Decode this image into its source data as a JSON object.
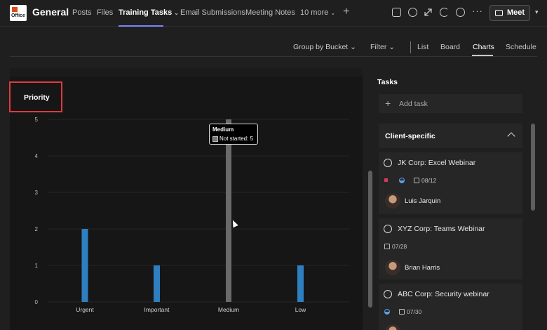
{
  "team": {
    "name": "General",
    "logo_text": "Office"
  },
  "tabs": [
    {
      "label": "Posts"
    },
    {
      "label": "Files"
    },
    {
      "label": "Training Tasks"
    },
    {
      "label": "Email Submissions"
    },
    {
      "label": "Meeting Notes"
    },
    {
      "label": "10 more"
    }
  ],
  "header_actions": {
    "meet_label": "Meet",
    "more": "···"
  },
  "viewbar": {
    "group_by": "Group by Bucket",
    "filter": "Filter",
    "list": "List",
    "board": "Board",
    "charts": "Charts",
    "schedule": "Schedule"
  },
  "chart_title": "Priority",
  "chart_data": {
    "type": "bar",
    "title": "Priority",
    "categories": [
      "Urgent",
      "Important",
      "Medium",
      "Low"
    ],
    "values": [
      2,
      1,
      5,
      1
    ],
    "ylim": [
      0,
      5
    ],
    "yticks": [
      "0",
      "1",
      "2",
      "3",
      "4",
      "5"
    ],
    "colors": [
      "#2e7fbf",
      "#2e7fbf",
      "#6a6a6a",
      "#2e7fbf"
    ],
    "highlighted": "Medium",
    "tooltip": {
      "category": "Medium",
      "label": "Not started: 5"
    },
    "grid": true
  },
  "tasks_panel": {
    "title": "Tasks",
    "add_task": "Add task",
    "bucket": "Client-specific",
    "cards": [
      {
        "title": "JK Corp: Excel Webinar",
        "due": "08/12",
        "assignee": "Luis Jarquin"
      },
      {
        "title": "XYZ Corp: Teams Webinar",
        "due": "07/28",
        "assignee": "Brian Harris"
      },
      {
        "title": "ABC Corp: Security webinar",
        "due": "07/30",
        "assignee": ""
      }
    ]
  },
  "colors": {
    "accent": "#7f85f5",
    "highlight_box": "#e0393e",
    "bar": "#2e7fbf",
    "bar_highlight": "#6a6a6a",
    "urgent_flag": "#d13b5f"
  }
}
